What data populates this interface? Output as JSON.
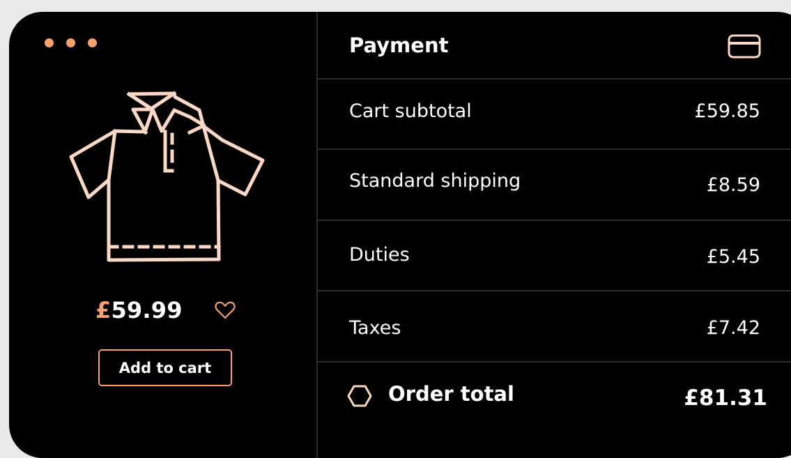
{
  "product": {
    "currency_symbol": "£",
    "price_amount": "59.99",
    "add_to_cart_label": "Add to cart",
    "image_icon": "polo-shirt-icon",
    "favorite_icon": "heart-icon"
  },
  "window_controls": {
    "dot_count": 3,
    "color": "#f5a170"
  },
  "payment": {
    "title": "Payment",
    "header_icon": "credit-card-icon",
    "lines": [
      {
        "label": "Cart subtotal",
        "value": "£59.85"
      },
      {
        "label": "Standard shipping",
        "value": "£8.59"
      },
      {
        "label": "Duties",
        "value": "£5.45"
      },
      {
        "label": "Taxes",
        "value": "£7.42"
      }
    ],
    "total_label": "Order total",
    "total_value": "£81.31",
    "total_icon": "hexagon-icon"
  },
  "colors": {
    "background": "#000000",
    "accent": "#f5a170",
    "line_art": "#fbd7c5",
    "divider": "#2c2c2c",
    "text": "#ffffff"
  }
}
